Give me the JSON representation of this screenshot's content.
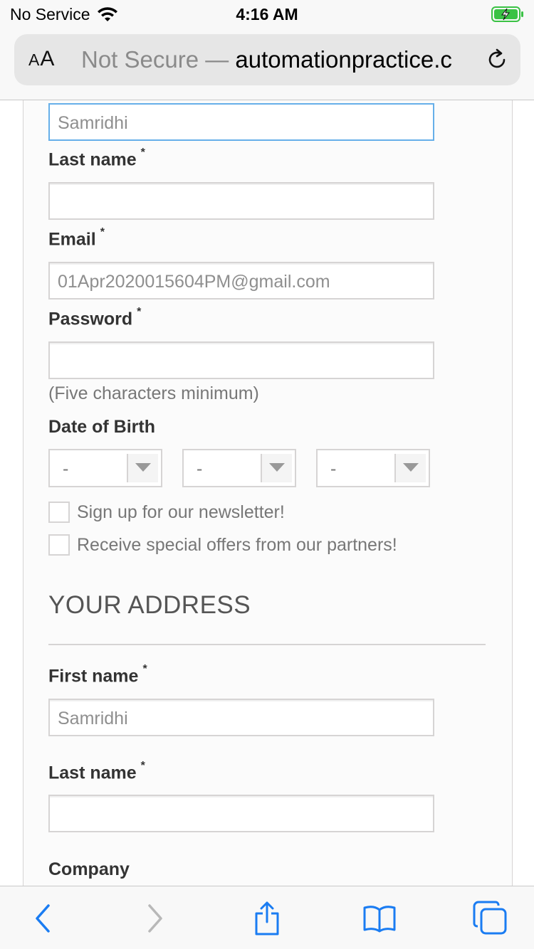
{
  "status_bar": {
    "carrier": "No Service",
    "time": "4:16 AM"
  },
  "browser": {
    "text_size_label": "AA",
    "url_insecure": "Not Secure —",
    "url_domain": "automationpractice.c"
  },
  "form": {
    "first_name_value": "Samridhi",
    "last_name_label": "Last name",
    "email_label": "Email",
    "email_value": "01Apr2020015604PM@gmail.com",
    "password_label": "Password",
    "password_hint": "(Five characters minimum)",
    "dob_label": "Date of Birth",
    "dob_day": "-",
    "dob_month": "-",
    "dob_year": "-",
    "newsletter_label": "Sign up for our newsletter!",
    "offers_label": "Receive special offers from our partners!",
    "required_mark": "*"
  },
  "address": {
    "section_title": "YOUR ADDRESS",
    "first_name_label": "First name",
    "first_name_value": "Samridhi",
    "last_name_label": "Last name",
    "company_label": "Company"
  },
  "colors": {
    "focus_border": "#66afe9",
    "ios_blue": "#1a7cf2"
  },
  "icons": [
    "wifi-icon",
    "battery-charging-icon",
    "reload-icon",
    "back-icon",
    "forward-icon",
    "share-icon",
    "bookmarks-icon",
    "tabs-icon",
    "dropdown-arrow-icon"
  ]
}
